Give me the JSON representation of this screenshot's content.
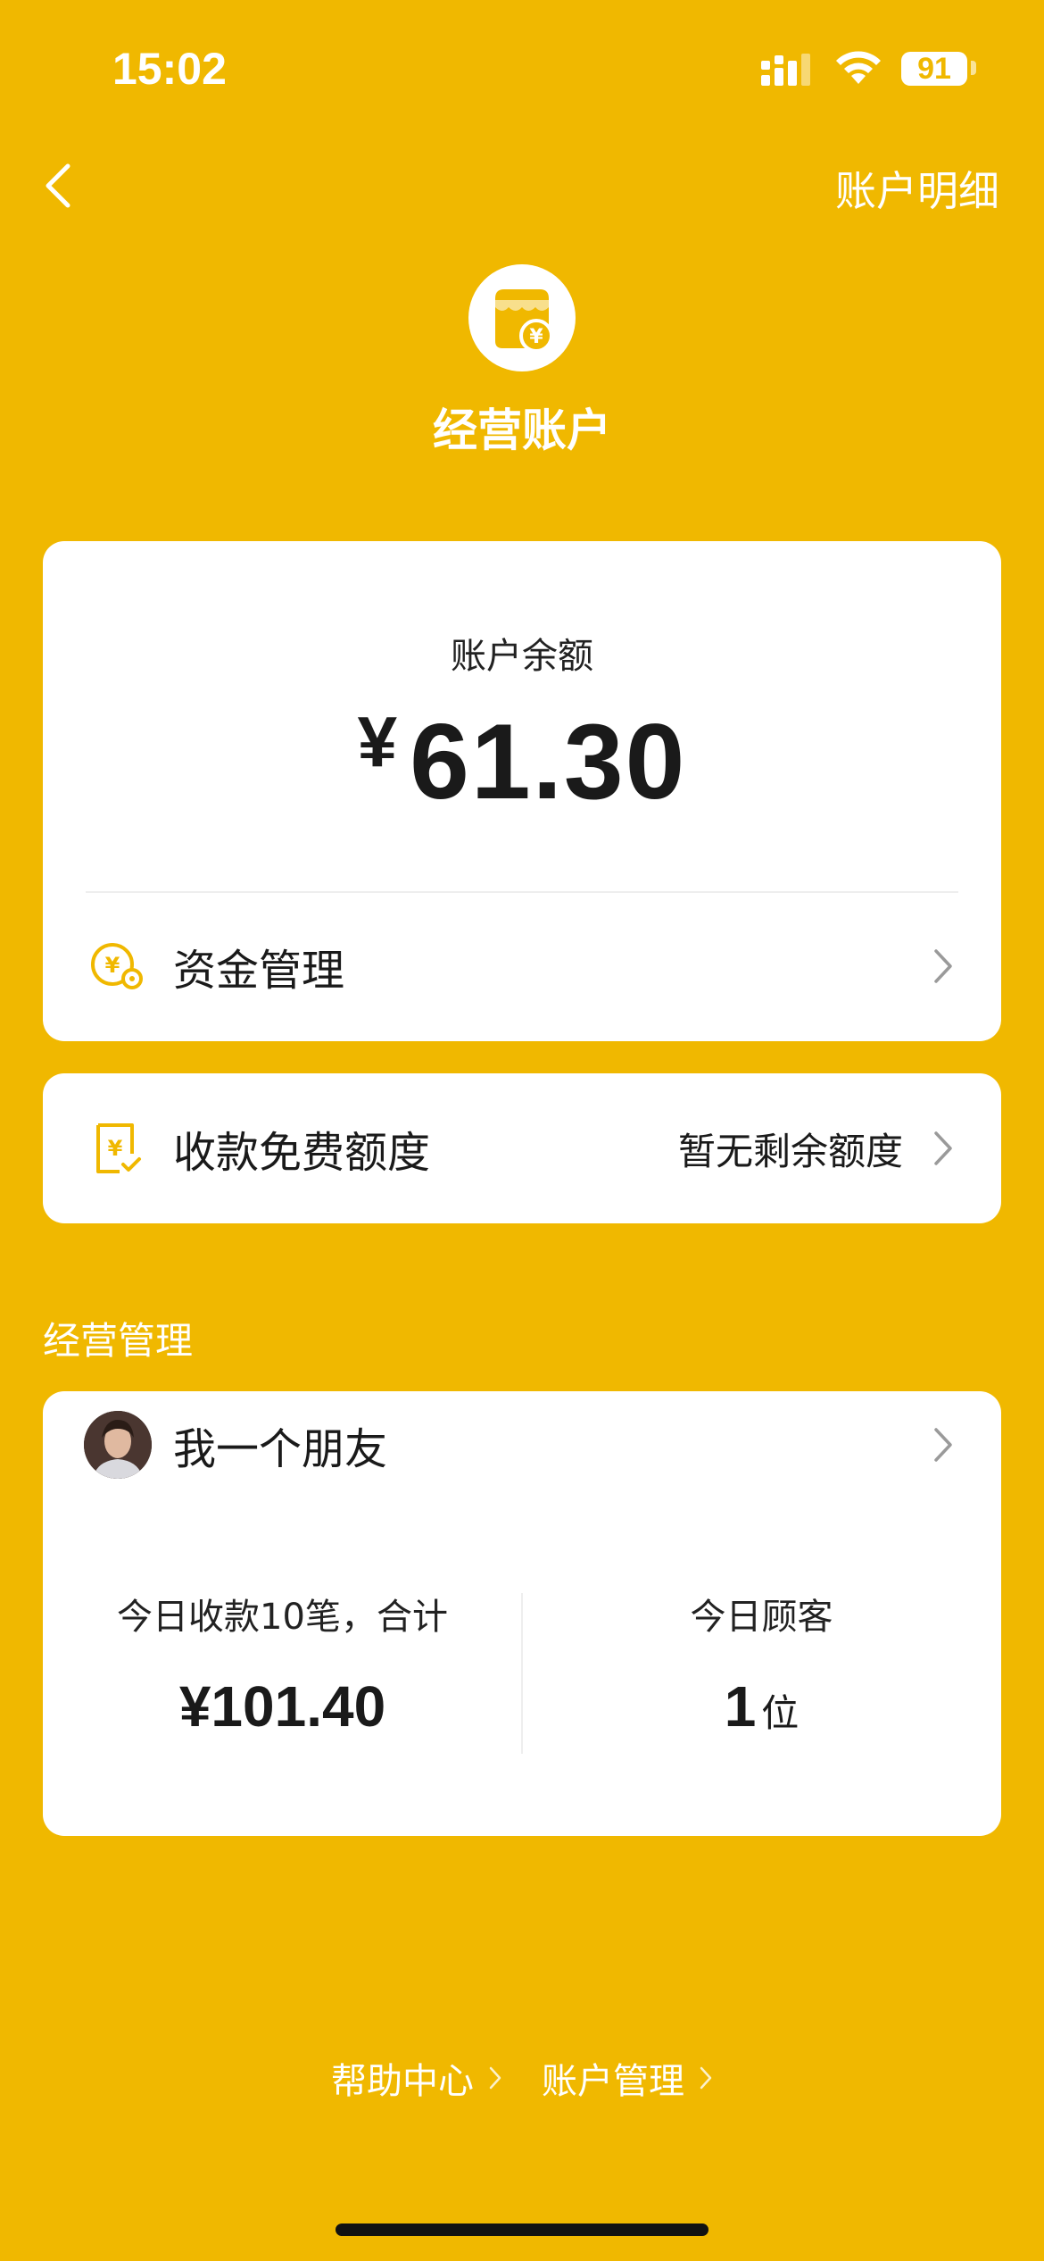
{
  "status_bar": {
    "time": "15:02",
    "battery": "91"
  },
  "nav": {
    "detail_link": "账户明细"
  },
  "header": {
    "title": "经营账户"
  },
  "balance": {
    "label": "账户余额",
    "currency": "¥",
    "amount": "61.30"
  },
  "fund_management": {
    "label": "资金管理"
  },
  "free_quota": {
    "label": "收款免费额度",
    "value": "暂无剩余额度"
  },
  "business_section": {
    "title": "经营管理",
    "shop_name": "我一个朋友",
    "today_income_label": "今日收款10笔，合计",
    "today_income_value": "¥101.40",
    "today_customers_label": "今日顾客",
    "today_customers_value": "1",
    "today_customers_unit": "位"
  },
  "footer": {
    "help_center": "帮助中心",
    "account_management": "账户管理"
  },
  "colors": {
    "background": "#F0B800",
    "card": "#FFFFFF",
    "text": "#1A1A1A"
  }
}
